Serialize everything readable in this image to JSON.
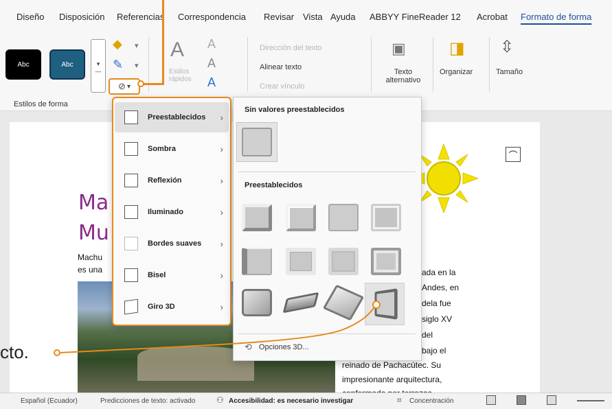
{
  "ribbon_tabs": [
    "Diseño",
    "Disposición",
    "Referencias",
    "Correspondencia",
    "Revisar",
    "Vista",
    "Ayuda",
    "ABBYY FineReader 12",
    "Acrobat",
    "Formato de forma"
  ],
  "active_tab": "Formato de forma",
  "shape_styles": {
    "box1": "Abc",
    "box2": "Abc",
    "group_label": "Estilos de forma",
    "effects_icon": "shape-effects-icon"
  },
  "wordart": {
    "styles_label": "Estilos rápidos",
    "text_direction": "Dirección del texto",
    "align_text": "Alinear texto",
    "create_link": "Crear vínculo",
    "alt_text": "Texto alternativo",
    "arrange": "Organizar",
    "size": "Tamaño"
  },
  "document": {
    "title_line1": "Ma",
    "title_line2": "Mu",
    "body_left1": "Machu",
    "body_left2": "es una",
    "body_right": [
      "ada en la",
      "Andes, en",
      "dela fue",
      "siglo XV",
      "del",
      "bajo el",
      "reinado de Pachacútec. Su",
      "impresionante arquitectura,",
      "conformada por terrazas"
    ],
    "callout_fragment": "cto."
  },
  "effects_menu": {
    "items": [
      "Preestablecidos",
      "Sombra",
      "Reflexión",
      "Iluminado",
      "Bordes suaves",
      "Bisel",
      "Giro 3D"
    ],
    "selected": "Preestablecidos"
  },
  "preset_panel": {
    "no_preset_heading": "Sin valores preestablecidos",
    "presets_heading": "Preestablecidos",
    "options_label": "Opciones 3D..."
  },
  "status_bar": {
    "language": "Español (Ecuador)",
    "predictions": "Predicciones de texto: activado",
    "accessibility": "Accesibilidad: es necesario investigar",
    "focus": "Concentración"
  },
  "accent_color": "#e68a1a"
}
